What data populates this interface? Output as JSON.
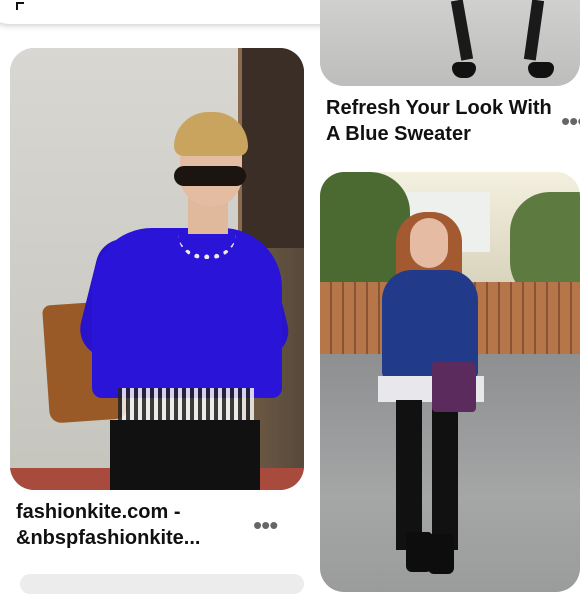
{
  "pins": [
    {
      "id": "pin-1",
      "title": "fashionkite.com - &nbspfashionkite...",
      "image_icon": "woman-blue-sweater-photo"
    },
    {
      "id": "pin-2",
      "title": "Refresh Your Look With A Blue Sweater",
      "image_icon": "black-heels-photo"
    },
    {
      "id": "pin-3",
      "title": "",
      "image_icon": "woman-by-fence-photo"
    }
  ],
  "more_options_glyph": "•••",
  "colors": {
    "background": "#ffffff",
    "text": "#111111",
    "muted": "#666666"
  }
}
